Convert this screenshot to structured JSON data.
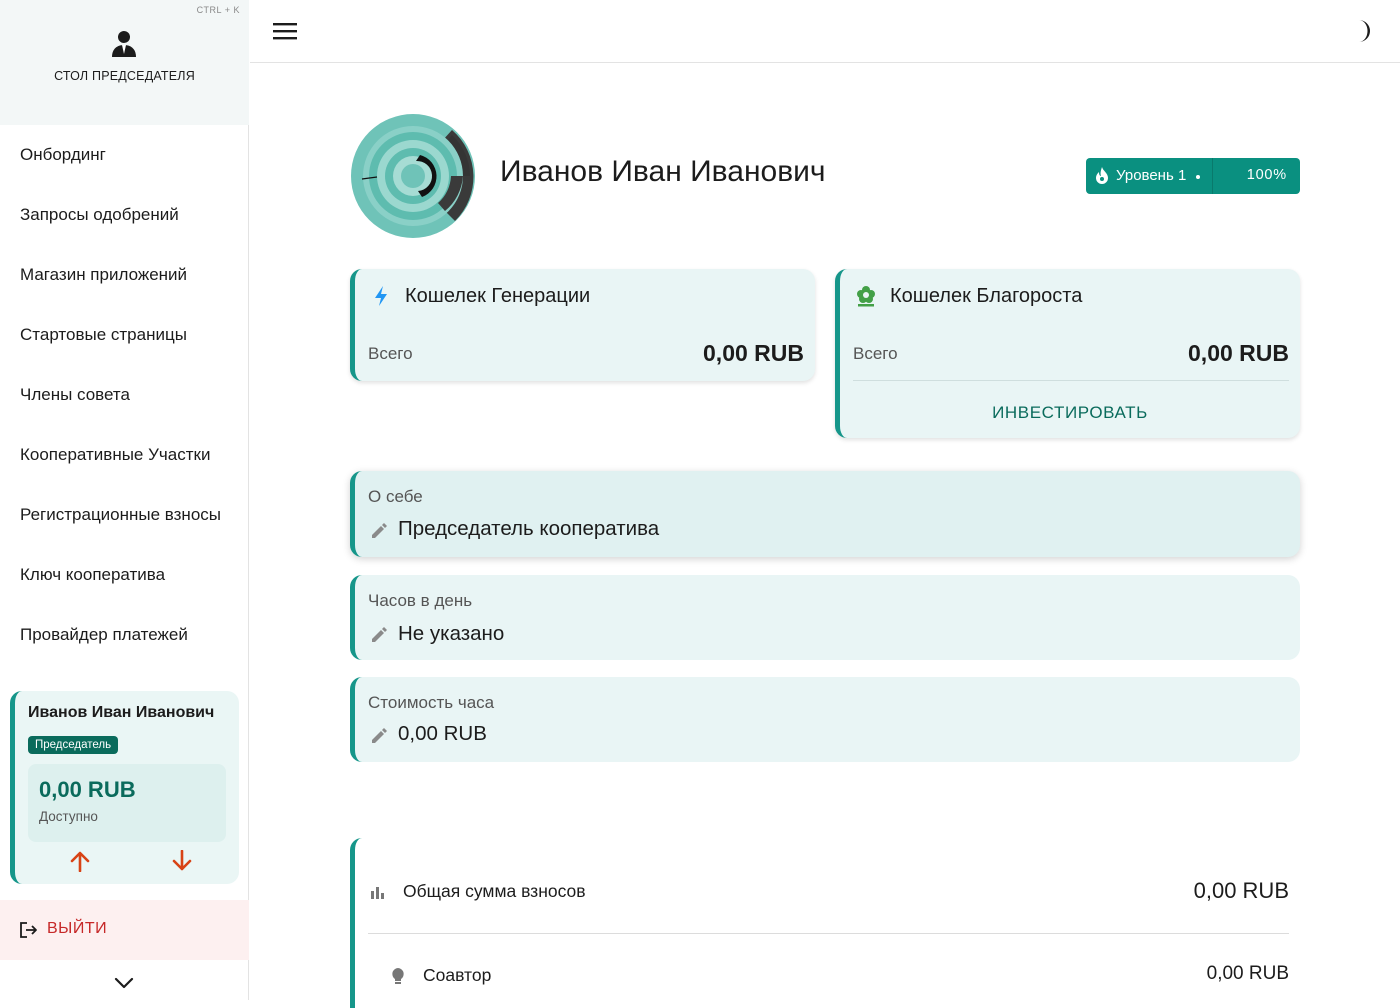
{
  "sidebar": {
    "hotkey": "CTRL + K",
    "desk_title": "СТОЛ ПРЕДСЕДАТЕЛЯ",
    "items": [
      {
        "label": "Онбординг"
      },
      {
        "label": "Запросы одобрений"
      },
      {
        "label": "Магазин приложений"
      },
      {
        "label": "Стартовые страницы"
      },
      {
        "label": "Члены совета"
      },
      {
        "label": "Кооперативные Участки"
      },
      {
        "label": "Регистрационные взносы"
      },
      {
        "label": "Ключ кооператива"
      },
      {
        "label": "Провайдер платежей"
      }
    ],
    "user_card": {
      "name": "Иванов Иван Иванович",
      "role": "Председатель",
      "amount": "0,00 RUB",
      "available_label": "Доступно"
    },
    "logout_label": "ВЫЙТИ"
  },
  "topbar": {
    "menu_icon": "hamburger-icon",
    "theme_icon": "moon-icon"
  },
  "profile": {
    "name": "Иванов Иван Иванович",
    "level_label": "Уровень 1",
    "level_percent": "100%"
  },
  "wallets": {
    "generation": {
      "title": "Кошелек Генерации",
      "total_label": "Всего",
      "amount": "0,00 RUB",
      "icon": "lightning-icon"
    },
    "blagorost": {
      "title": "Кошелек Благороста",
      "total_label": "Всего",
      "amount": "0,00 RUB",
      "invest_label": "ИНВЕСТИРОВАТЬ",
      "icon": "flower-icon"
    }
  },
  "fields": {
    "about": {
      "label": "О себе",
      "value": "Председатель кооператива"
    },
    "hours": {
      "label": "Часов в день",
      "value": "Не указано"
    },
    "rate": {
      "label": "Стоимость часа",
      "value": "0,00 RUB"
    }
  },
  "stats": {
    "total": {
      "label": "Общая сумма взносов",
      "value": "0,00 RUB"
    },
    "coauthor": {
      "label": "Соавтор",
      "value": "0,00 RUB"
    }
  },
  "colors": {
    "accent": "#16968a",
    "accent_dark": "#0a6b5c",
    "level_bg": "#0a9080",
    "logout": "#c62828",
    "arrows": "#d84315"
  }
}
